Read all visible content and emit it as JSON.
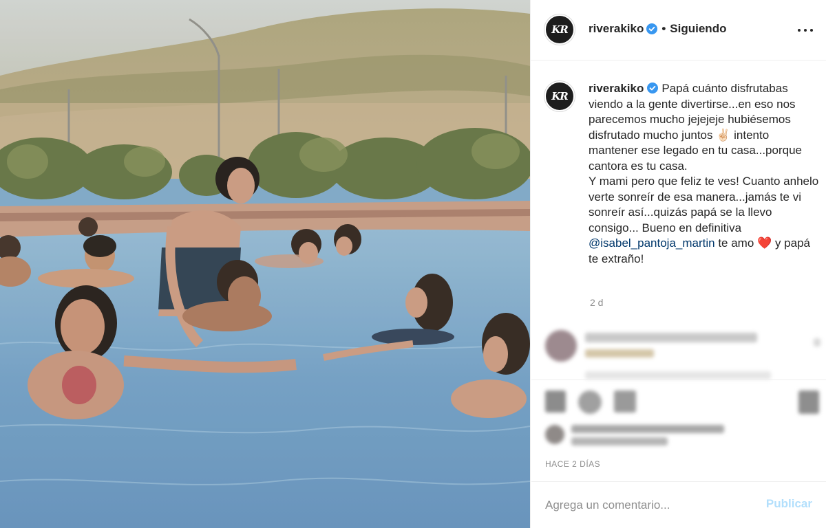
{
  "post": {
    "username": "riverakiko",
    "avatar_initials": "KR",
    "follow_separator": "•",
    "follow_status": "Siguiendo",
    "more_icon": "more-horizontal-icon",
    "verified_icon": "verified-badge-icon"
  },
  "caption": {
    "username": "riverakiko",
    "text_1": "Papá cuánto disfrutabas viendo a la gente divertirse...en eso nos parecemos mucho jejejeje hubiésemos disfrutado mucho juntos",
    "hand_emoji": "✌🏻",
    "text_2": "intento mantener ese legado en tu casa...porque cantora es tu casa.",
    "text_3": "Y mami pero que feliz te ves! Cuanto anhelo verte sonreír de esa manera...jamás te vi sonreír así...quizás papá se la llevo consigo... Bueno en definitiva",
    "mention": "@isabel_pantoja_martin",
    "text_4": "te amo",
    "heart_emoji": "❤️",
    "text_5": "y papá te extraño!",
    "age": "2 d"
  },
  "footer": {
    "timestamp": "HACE 2 DÍAS",
    "comment_placeholder": "Agrega un comentario...",
    "publish_label": "Publicar"
  },
  "colors": {
    "link": "#00376b",
    "publish_disabled": "#b2dffc",
    "muted": "#8e8e8e",
    "verified": "#3897f0"
  }
}
